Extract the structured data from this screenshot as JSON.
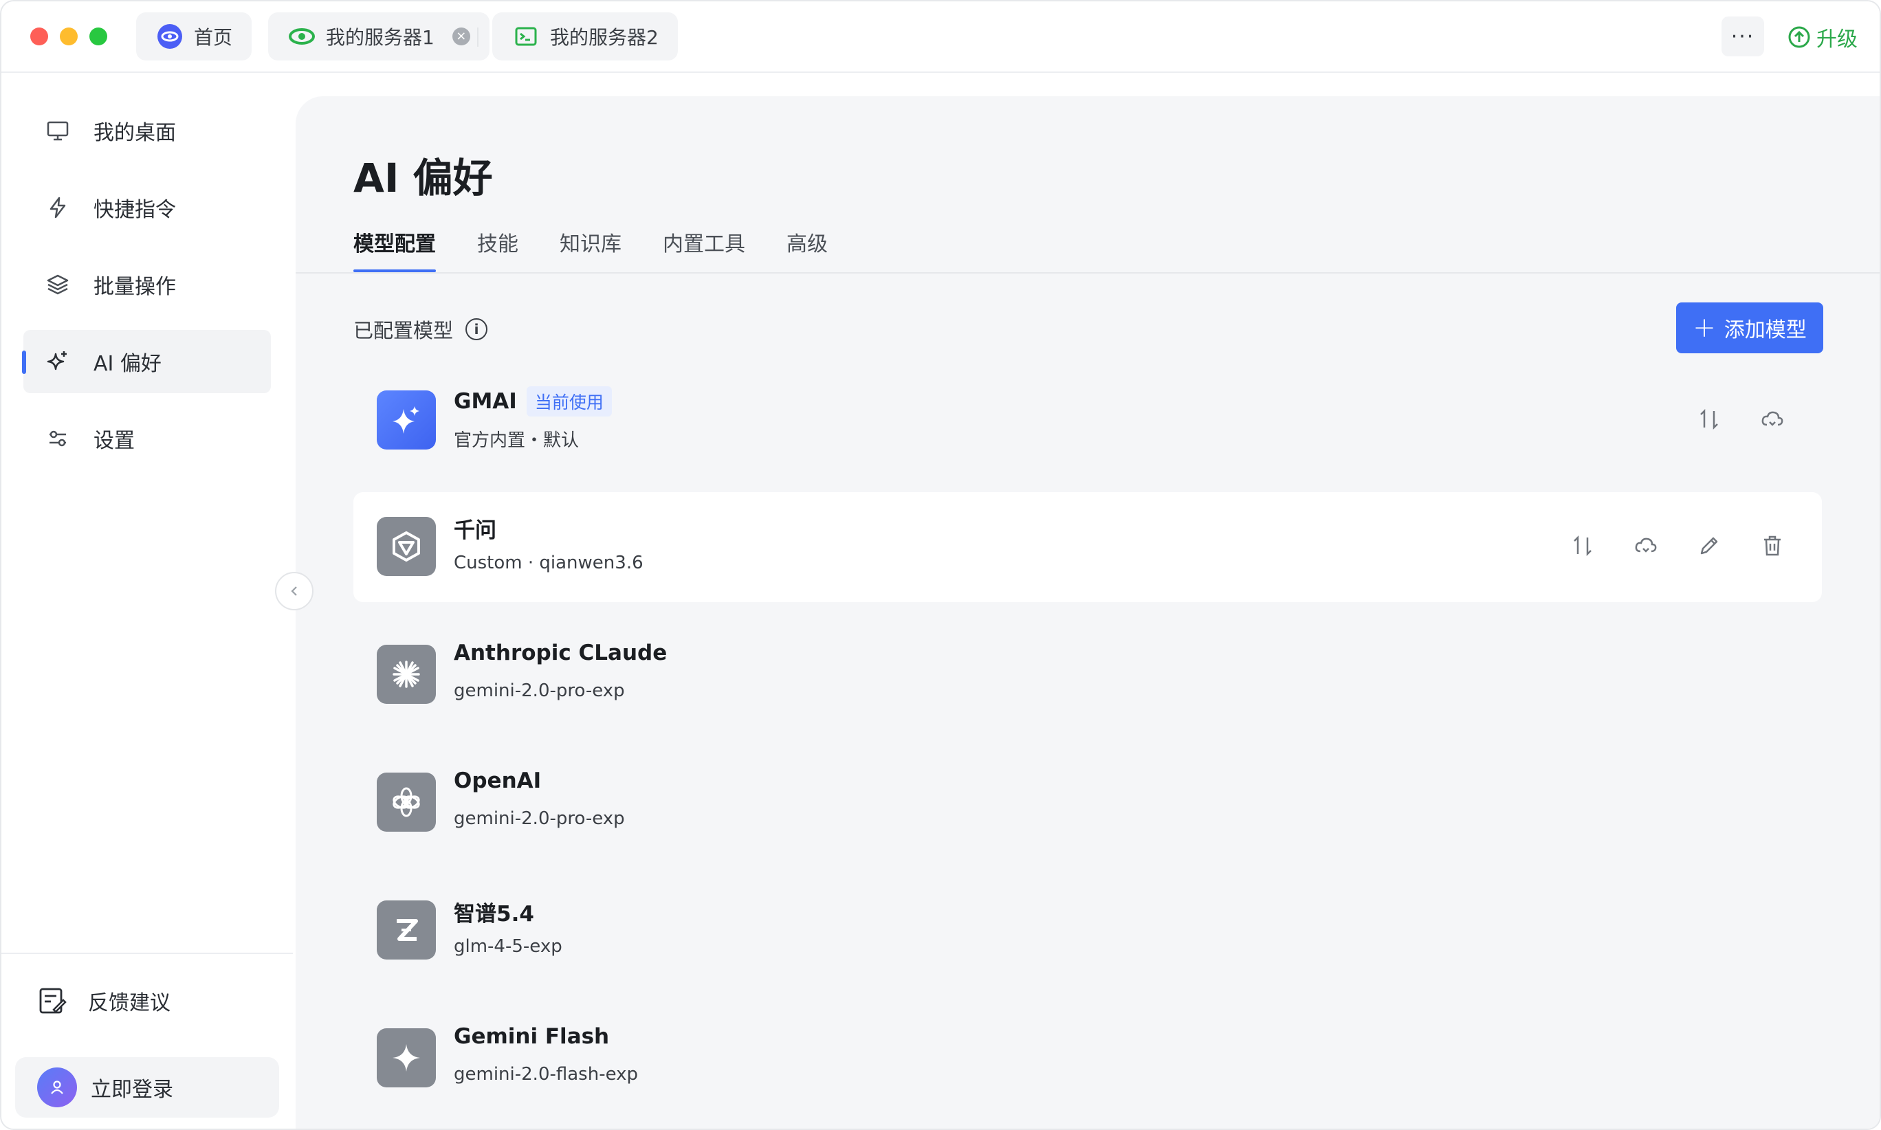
{
  "tabs": [
    {
      "label": "首页",
      "icon": "home-logo-icon"
    },
    {
      "label": "我的服务器1",
      "icon": "eye-logo-icon",
      "close": "×"
    },
    {
      "label": "我的服务器2",
      "icon": "terminal-icon"
    }
  ],
  "titlebar": {
    "more_label": "···",
    "upgrade_label": "升级"
  },
  "sidebar": {
    "items": [
      {
        "label": "我的桌面",
        "icon": "monitor-icon"
      },
      {
        "label": "快捷指令",
        "icon": "lightning-icon"
      },
      {
        "label": "批量操作",
        "icon": "layers-icon"
      },
      {
        "label": "AI 偏好",
        "icon": "sparkle-icon",
        "active": true
      },
      {
        "label": "设置",
        "icon": "sliders-icon"
      }
    ],
    "feedback": "反馈建议",
    "login": "立即登录"
  },
  "main": {
    "title": "AI 偏好",
    "tabs": [
      "模型配置",
      "技能",
      "知识库",
      "内置工具",
      "高级"
    ],
    "active_tab": "模型配置",
    "section_label": "已配置模型",
    "add_button": "添加模型",
    "add_plus": "+"
  },
  "models": [
    {
      "name": "GMAI",
      "badge": "当前使用",
      "sub": "官方内置・默认",
      "logo": "sparkle-logo-icon"
    },
    {
      "name": "千问",
      "sub": "Custom · qianwen3.6",
      "logo": "qianwen-logo-icon"
    },
    {
      "name": "Anthropic CLaude",
      "sub": "gemini-2.0-pro-exp",
      "logo": "claude-logo-icon"
    },
    {
      "name": "OpenAI",
      "sub": "gemini-2.0-pro-exp",
      "logo": "openai-logo-icon"
    },
    {
      "name": "智谱5.4",
      "sub": "glm-4-5-exp",
      "logo": "zhipu-logo-icon"
    },
    {
      "name": "Gemini Flash",
      "sub": "gemini-2.0-flash-exp",
      "logo": "gemini-logo-icon"
    }
  ],
  "colors": {
    "accent": "#3f6ff5",
    "upgrade": "#2ba84a",
    "panel_bg": "#f5f6f8"
  }
}
